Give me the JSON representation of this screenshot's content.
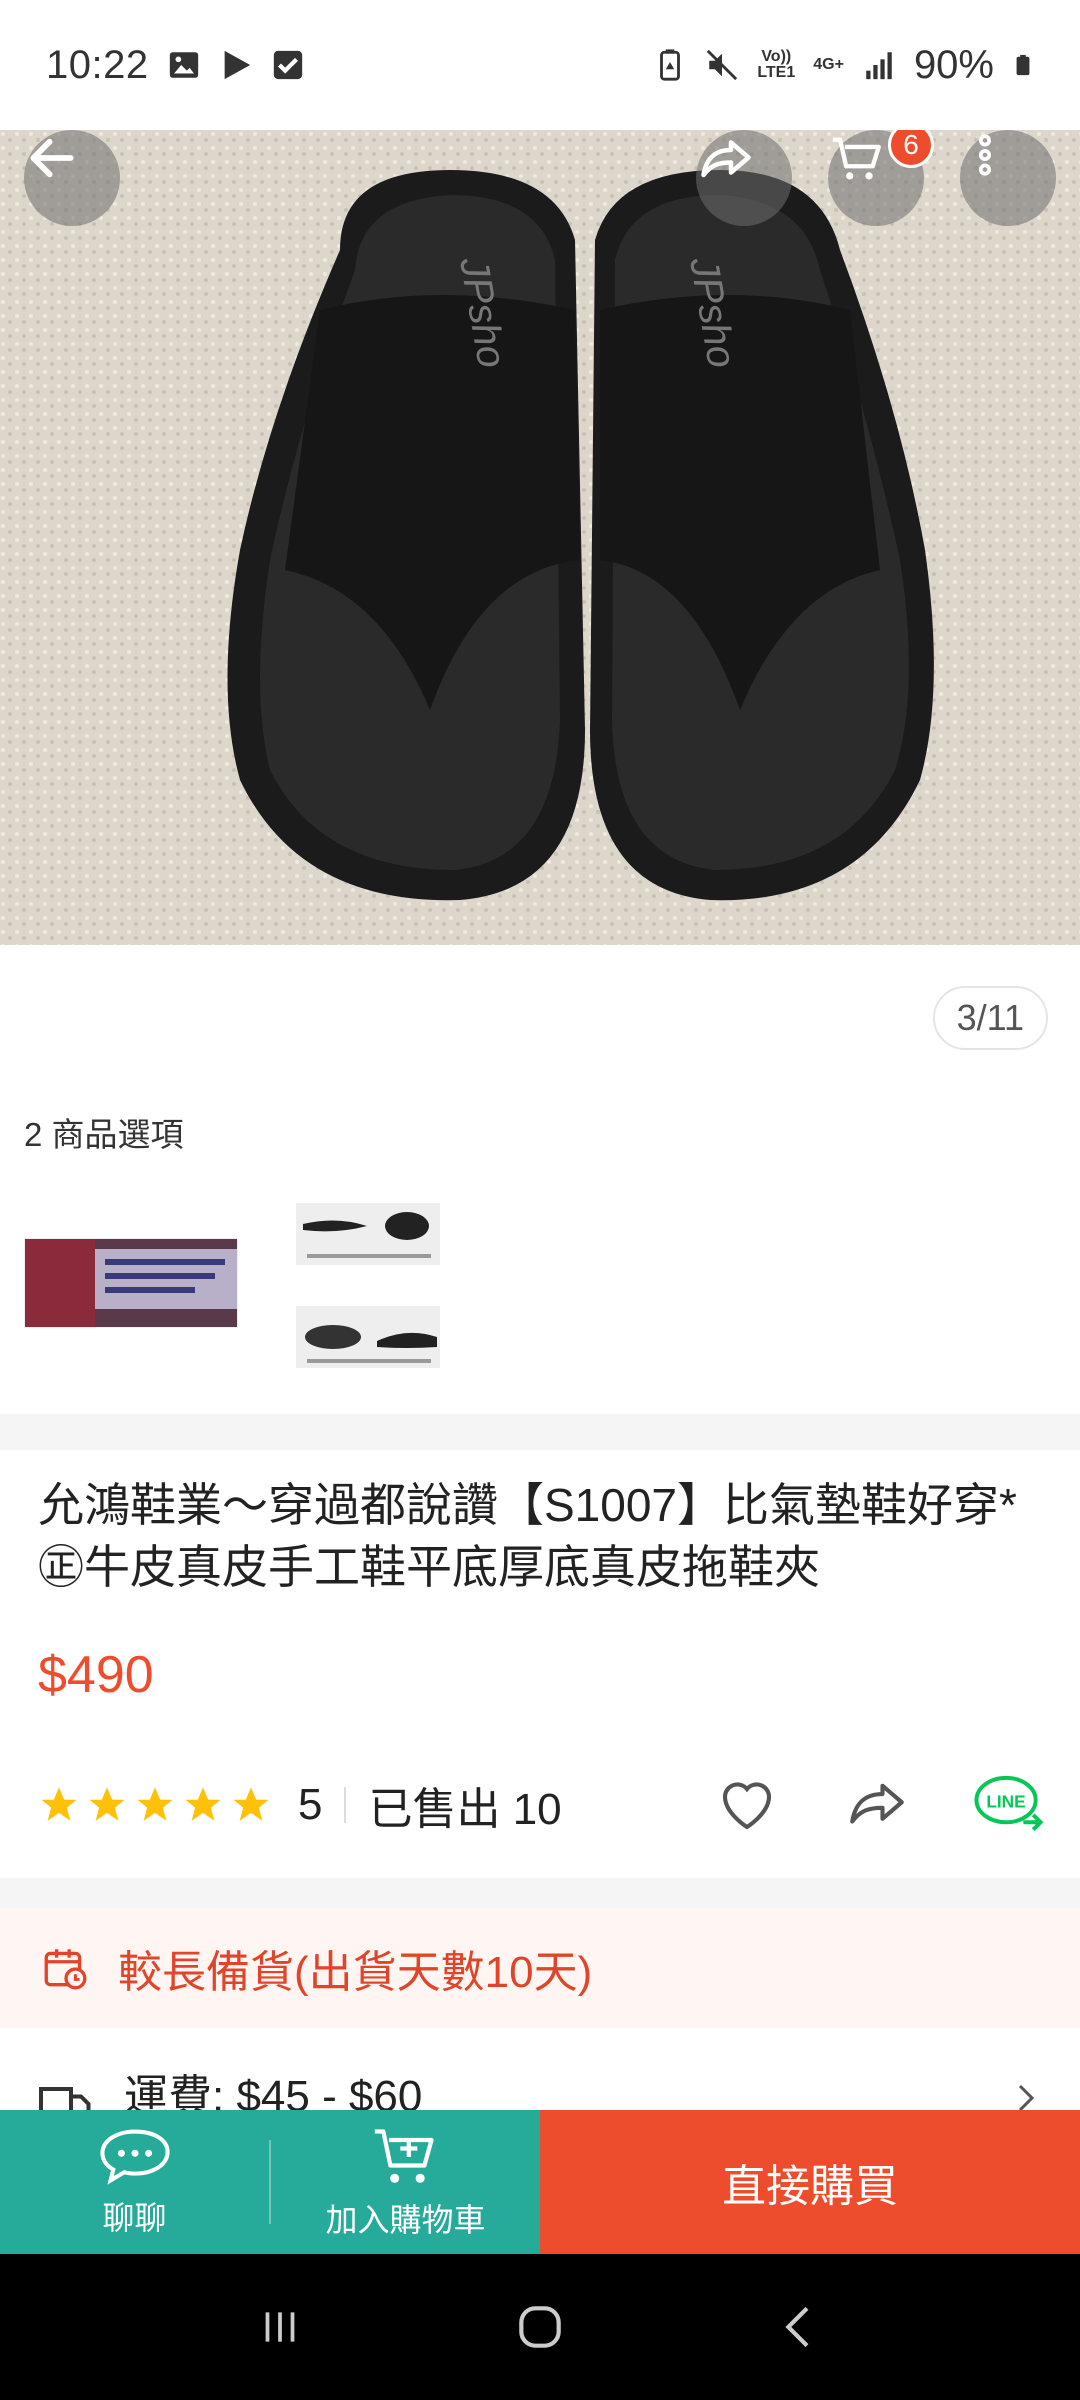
{
  "status_bar": {
    "time": "10:22",
    "network_top": "Vo))",
    "network_bottom": "LTE1",
    "network_type": "4G+",
    "battery": "90%",
    "icons": [
      "gallery-icon",
      "play-icon",
      "check-icon",
      "battery-saver-icon",
      "mute-icon",
      "signal-icon",
      "battery-icon"
    ]
  },
  "header": {
    "cart_count": "6"
  },
  "gallery": {
    "counter": "3/11"
  },
  "options": {
    "title": "2 商品選項"
  },
  "product": {
    "title": "允鴻鞋業～穿過都說讚【S1007】比氣墊鞋好穿*㊣牛皮真皮手工鞋平底厚底真皮拖鞋夾",
    "price": "$490",
    "rating": "5",
    "sold": "已售出 10",
    "stars_filled": 5
  },
  "lead_time": {
    "text": "較長備貨(出貨天數10天)"
  },
  "shipping": {
    "text": "運費: $45 - $60"
  },
  "bottom_bar": {
    "chat_label": "聊聊",
    "add_cart_label": "加入購物車",
    "buy_label": "直接購買"
  },
  "colors": {
    "accent": "#ee4d2d",
    "teal": "#26aa99",
    "star": "#ffc107"
  }
}
